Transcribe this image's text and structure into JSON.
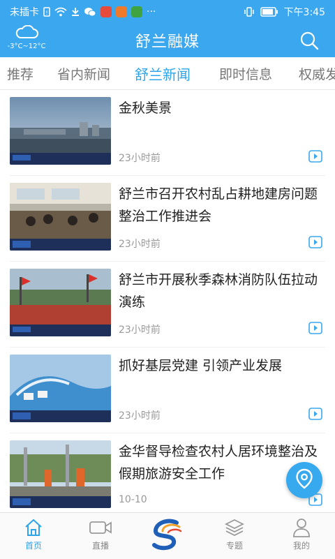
{
  "status_bar": {
    "carrier": "未插卡",
    "more": "···",
    "time": "下午3:45"
  },
  "header": {
    "title": "舒兰融媒",
    "weather": {
      "temp": "-3°C~12°C",
      "icon": "cloud-icon"
    },
    "search_icon": "search-icon"
  },
  "tabs": [
    {
      "label": "推荐",
      "active": false
    },
    {
      "label": "省内新闻",
      "active": false
    },
    {
      "label": "舒兰新闻",
      "active": true
    },
    {
      "label": "即时信息",
      "active": false
    },
    {
      "label": "权威发",
      "active": false
    }
  ],
  "news": [
    {
      "title": "金秋美景",
      "time": "23小时前"
    },
    {
      "title": "舒兰市召开农村乱占耕地建房问题整治工作推进会",
      "time": "23小时前"
    },
    {
      "title": "舒兰市开展秋季森林消防队伍拉动演练",
      "time": "23小时前"
    },
    {
      "title": "抓好基层党建 引领产业发展",
      "time": "23小时前"
    },
    {
      "title": "金华督导检查农村人居环境整治及假期旅游安全工作",
      "time": "10-10"
    }
  ],
  "bottom_nav": [
    {
      "label": "首页",
      "icon": "home-icon",
      "active": true
    },
    {
      "label": "直播",
      "icon": "video-camera-icon",
      "active": false
    },
    {
      "label": "",
      "icon": "app-logo-icon",
      "active": false
    },
    {
      "label": "专题",
      "icon": "layers-icon",
      "active": false
    },
    {
      "label": "我的",
      "icon": "user-icon",
      "active": false
    }
  ],
  "colors": {
    "header_blue": "#3ba7ee",
    "accent": "#2ea4ea",
    "text": "#222222",
    "muted": "#999999"
  },
  "floating_button_icon": "location-pin-icon"
}
